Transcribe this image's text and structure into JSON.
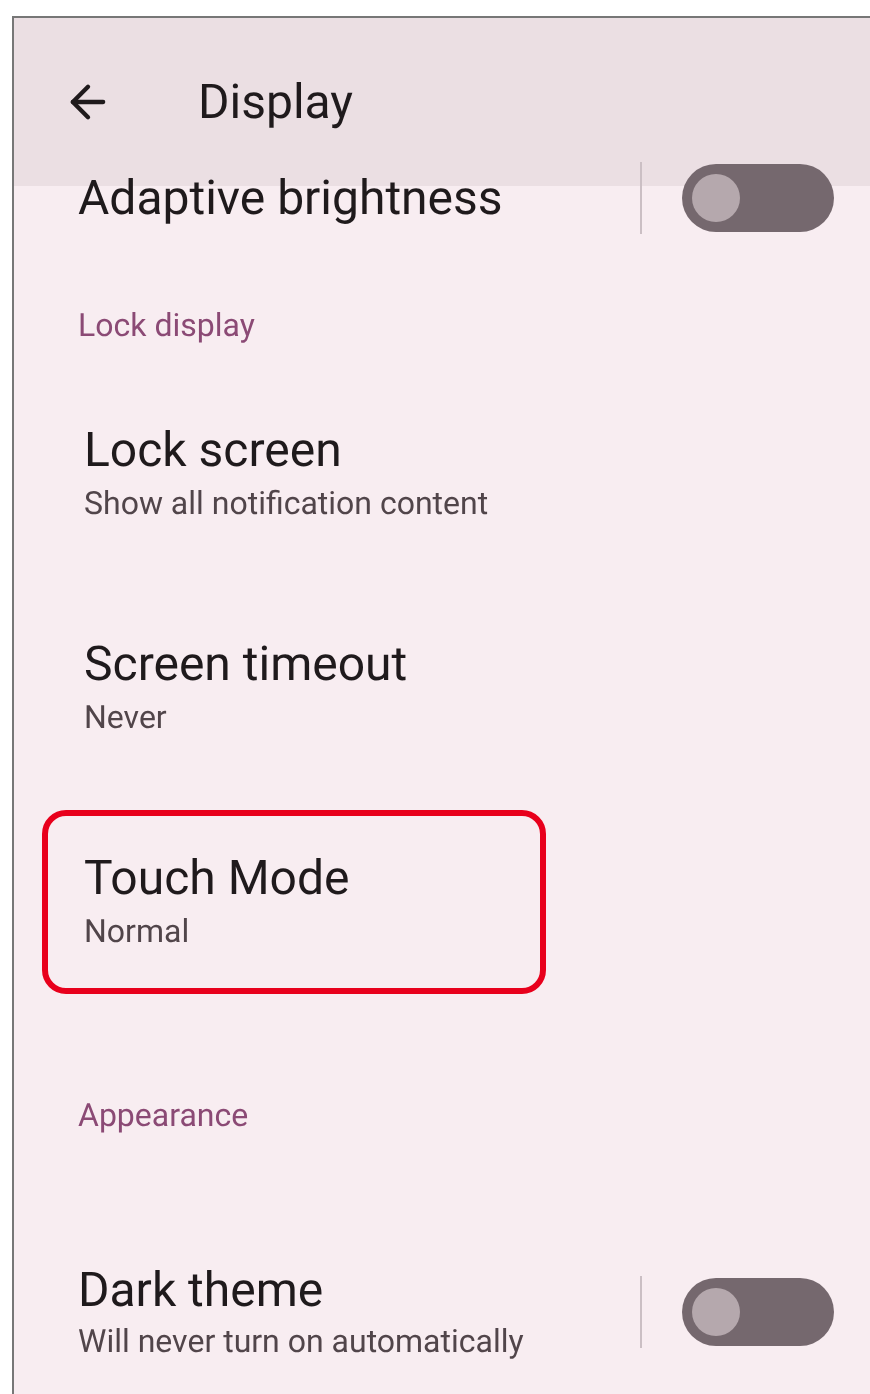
{
  "app_bar": {
    "title": "Display"
  },
  "items": [
    {
      "kind": "switch",
      "title": "Adaptive brightness",
      "on": false
    },
    {
      "kind": "header",
      "title": "Lock display"
    },
    {
      "kind": "setting",
      "title": "Lock screen",
      "summary": "Show all notification content",
      "highlighted": false
    },
    {
      "kind": "setting",
      "title": "Screen timeout",
      "summary": "Never",
      "highlighted": false
    },
    {
      "kind": "setting",
      "title": "Touch Mode",
      "summary": "Normal",
      "highlighted": true
    },
    {
      "kind": "header",
      "title": "Appearance"
    },
    {
      "kind": "switch",
      "title": "Dark theme",
      "summary": "Will never turn on automatically",
      "on": false
    }
  ]
}
